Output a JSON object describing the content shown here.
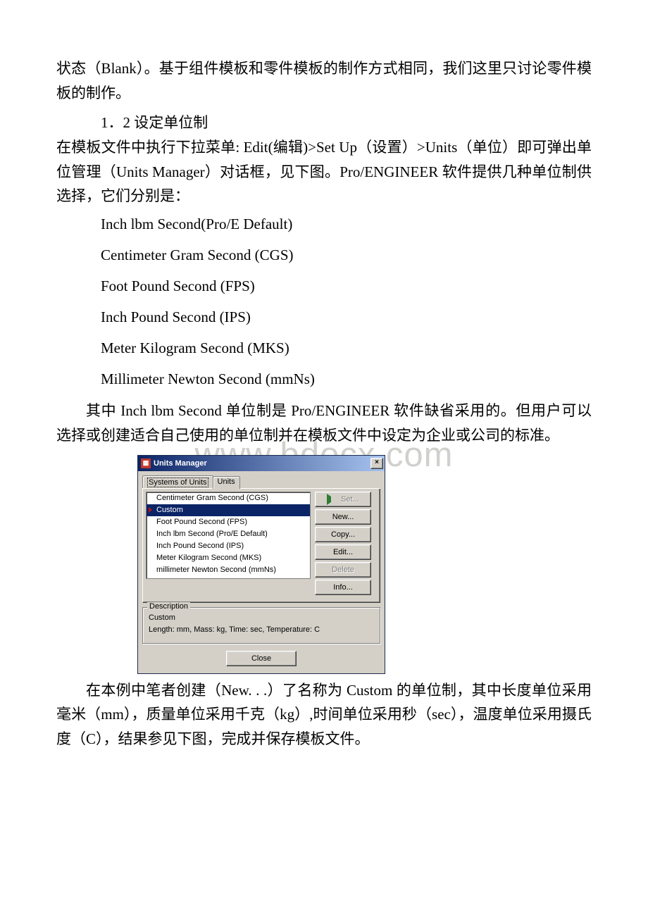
{
  "watermark": "www.bdocx.com",
  "paragraphs": {
    "p1": "状态（Blank）。基于组件模板和零件模板的制作方式相同，我们这里只讨论零件模板的制作。",
    "h1": "1．2 设定单位制",
    "p2a": " 在模板文件中执行下拉菜单: Edit(编辑)>Set Up（设置）>Units（单位）即可弹出单位管理（Units Manager）对话框，见下图。Pro/ENGINEER 软件提供几种单位制供选择，它们分别是：",
    "b1": "Inch lbm Second(Pro/E Default)",
    "b2": "Centimeter Gram Second (CGS)",
    "b3": "Foot Pound Second (FPS)",
    "b4": "Inch Pound Second (IPS)",
    "b5": "Meter Kilogram Second (MKS)",
    "b6": "Millimeter Newton Second (mmNs)",
    "p3": " 其中 Inch lbm Second 单位制是 Pro/ENGINEER 软件缺省采用的。但用户可以选择或创建适合自己使用的单位制并在模板文件中设定为企业或公司的标准。",
    "p4": "在本例中笔者创建（New. . .）了名称为 Custom 的单位制，其中长度单位采用毫米（mm），质量单位采用千克（kg）,时间单位采用秒（sec），温度单位采用摄氏度（C），结果参见下图，完成并保存模板文件。"
  },
  "dialog": {
    "title": "Units Manager",
    "close_x": "×",
    "tabs": {
      "t1": "Systems of Units",
      "t2": "Units"
    },
    "list": {
      "i0": "Centimeter Gram Second (CGS)",
      "i1": "Custom",
      "i2": "Foot Pound Second (FPS)",
      "i3": "Inch lbm Second (Pro/E Default)",
      "i4": "Inch Pound Second (IPS)",
      "i5": "Meter Kilogram Second (MKS)",
      "i6": "millimeter Newton Second (mmNs)"
    },
    "buttons": {
      "set": "Set...",
      "new": "New...",
      "copy": "Copy...",
      "edit": "Edit...",
      "del": "Delete",
      "info": "Info..."
    },
    "description": {
      "legend": "Description",
      "line1": "Custom",
      "line2": "Length: mm, Mass: kg, Time: sec, Temperature: C"
    },
    "close_btn": "Close"
  }
}
